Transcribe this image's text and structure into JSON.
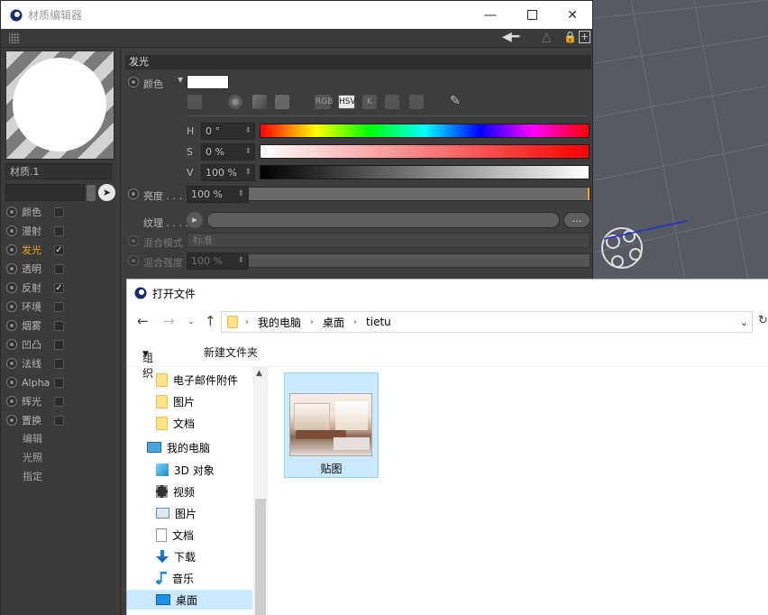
{
  "material_editor": {
    "title": "材质编辑器",
    "material_name": "材质.1",
    "section_title": "发光",
    "channels": [
      {
        "label": "颜色",
        "checked": false,
        "active": false
      },
      {
        "label": "漫射",
        "checked": false,
        "active": false
      },
      {
        "label": "发光",
        "checked": true,
        "active": true
      },
      {
        "label": "透明",
        "checked": false,
        "active": false
      },
      {
        "label": "反射",
        "checked": true,
        "active": false
      },
      {
        "label": "环境",
        "checked": false,
        "active": false
      },
      {
        "label": "烟雾",
        "checked": false,
        "active": false
      },
      {
        "label": "凹凸",
        "checked": false,
        "active": false
      },
      {
        "label": "法线",
        "checked": false,
        "active": false
      },
      {
        "label": "Alpha",
        "checked": false,
        "active": false
      },
      {
        "label": "辉光",
        "checked": false,
        "active": false
      },
      {
        "label": "置换",
        "checked": false,
        "active": false
      }
    ],
    "extra_items": [
      "编辑",
      "光照",
      "指定"
    ],
    "check_mark": "✓",
    "color_label": "颜色",
    "color_swatch": "#ffffff",
    "mode_buttons": [
      "RGB",
      "HSV",
      "K"
    ],
    "h_label": "H",
    "h_value": "0 °",
    "s_label": "S",
    "s_value": "0 %",
    "v_label": "V",
    "v_value": "100 %",
    "brightness_label": "亮度 . . . .",
    "brightness_value": "100 %",
    "texture_label": "纹理 . . . .",
    "texture_more": "...",
    "blend_mode_label": "混合模式",
    "blend_mode_value": "标准",
    "blend_strength_label": "混合强度",
    "blend_strength_value": "100 %",
    "accent_color": "#f3a31c"
  },
  "dialog": {
    "title": "打开文件",
    "breadcrumb": [
      "我的电脑",
      "桌面",
      "tietu"
    ],
    "organize": "组织",
    "new_folder": "新建文件夹",
    "nav_items": [
      {
        "label": "电子邮件附件",
        "icon": "folder-icon"
      },
      {
        "label": "图片",
        "icon": "folder-icon"
      },
      {
        "label": "文档",
        "icon": "folder-icon"
      },
      {
        "label": "我的电脑",
        "icon": "computer-icon"
      },
      {
        "label": "3D 对象",
        "icon": "cube-icon"
      },
      {
        "label": "视频",
        "icon": "film-icon"
      },
      {
        "label": "图片",
        "icon": "pictures-icon"
      },
      {
        "label": "文档",
        "icon": "document-icon"
      },
      {
        "label": "下载",
        "icon": "download-icon"
      },
      {
        "label": "音乐",
        "icon": "music-icon"
      },
      {
        "label": "桌面",
        "icon": "desktop-icon"
      }
    ],
    "selected_nav": "桌面",
    "file": {
      "name": "贴图"
    }
  }
}
